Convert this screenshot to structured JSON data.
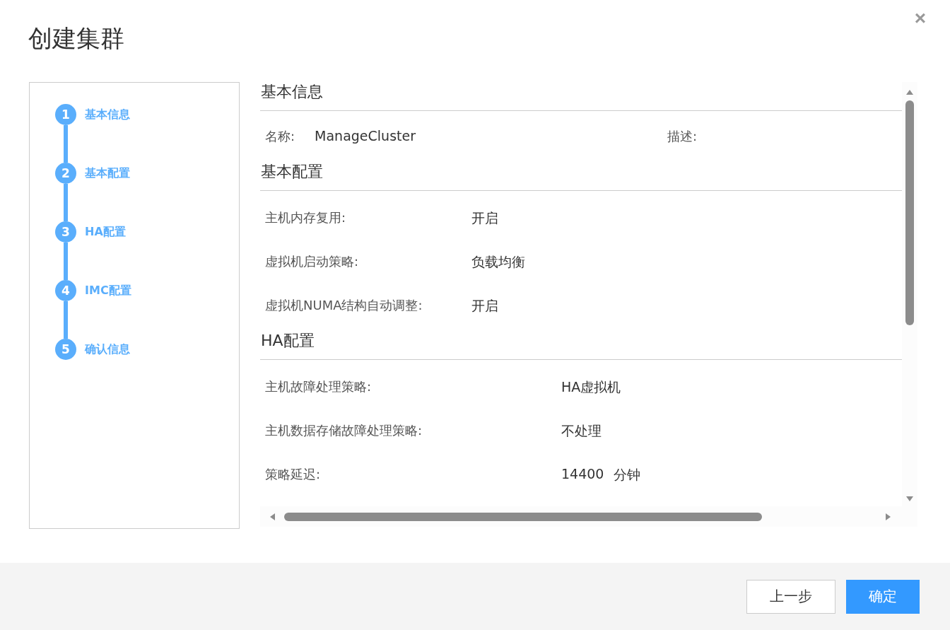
{
  "dialog": {
    "title": "创建集群",
    "close": "×"
  },
  "steps": [
    {
      "number": "1",
      "label": "基本信息"
    },
    {
      "number": "2",
      "label": "基本配置"
    },
    {
      "number": "3",
      "label": "HA配置"
    },
    {
      "number": "4",
      "label": "IMC配置"
    },
    {
      "number": "5",
      "label": "确认信息"
    }
  ],
  "sections": [
    {
      "title": "基本信息",
      "kind": "inline",
      "fields": [
        {
          "label": "名称:",
          "value": "ManageCluster"
        },
        {
          "label": "描述:"
        }
      ]
    },
    {
      "title": "基本配置",
      "kind": "list",
      "fields": [
        {
          "label": "主机内存复用:",
          "value": "开启"
        },
        {
          "label": "虚拟机启动策略:",
          "value": "负载均衡"
        },
        {
          "label": "虚拟机NUMA结构自动调整:",
          "value": "开启"
        }
      ]
    },
    {
      "title": "HA配置",
      "kind": "list",
      "fields": [
        {
          "label": "主机故障处理策略:",
          "value": "HA虚拟机"
        },
        {
          "label": "主机数据存储故障处理策略:",
          "value": "不处理"
        },
        {
          "label": "策略延迟:",
          "value": "14400",
          "unit": "分钟"
        }
      ]
    }
  ],
  "buttons": [
    {
      "label": "上一步",
      "kind": "secondary"
    },
    {
      "label": "确定",
      "kind": "primary"
    }
  ]
}
